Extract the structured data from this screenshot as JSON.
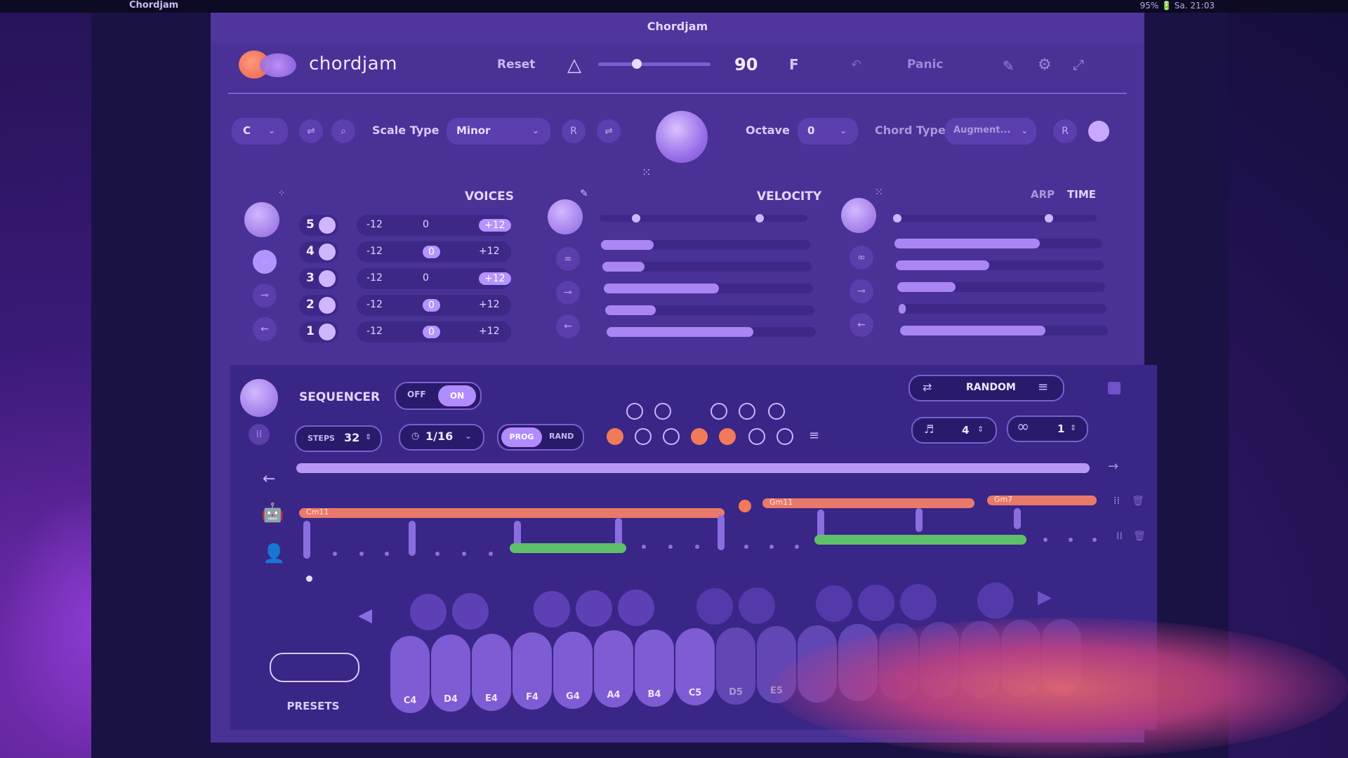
{
  "menubar": {
    "app": "Chordjam",
    "status": "95% 🔋  Sa. 21:03"
  },
  "window": {
    "title": "Chordjam"
  },
  "header": {
    "brand": "chordjam",
    "reset": "Reset",
    "bpm": "90",
    "key": "F",
    "panic": "Panic"
  },
  "controls": {
    "root": "C",
    "scale_label": "Scale Type",
    "scale": "Minor",
    "r": "R",
    "octave_label": "Octave",
    "octave": "0",
    "chord_label": "Chord Type",
    "chord": "Augment..."
  },
  "voices": {
    "title": "VOICES",
    "rows": [
      {
        "n": "5",
        "lo": "-12",
        "mid": "0",
        "hi": "+12"
      },
      {
        "n": "4",
        "lo": "-12",
        "mid": "0",
        "hi": "+12"
      },
      {
        "n": "3",
        "lo": "-12",
        "mid": "0",
        "hi": "+12"
      },
      {
        "n": "2",
        "lo": "-12",
        "mid": "0",
        "hi": "+12"
      },
      {
        "n": "1",
        "lo": "-12",
        "mid": "0",
        "hi": "+12"
      }
    ]
  },
  "velocity": {
    "title": "VELOCITY",
    "levels": [
      0.25,
      0.2,
      0.55,
      0.24,
      0.7
    ]
  },
  "arp": {
    "arp": "ARP",
    "time": "TIME",
    "levels": [
      0.7,
      0.45,
      0.28,
      0.03,
      0.7
    ]
  },
  "sequencer": {
    "title": "SEQUENCER",
    "off": "OFF",
    "on": "ON",
    "steps_label": "STEPS",
    "steps": "32",
    "rate": "1/16",
    "prog": "PROG",
    "rand": "RAND",
    "random": "RANDOM",
    "count1": "4",
    "count2": "1",
    "chords": [
      "Cm11",
      "Gm11",
      "Gm7"
    ]
  },
  "keys": [
    "C4",
    "D4",
    "E4",
    "F4",
    "G4",
    "A4",
    "B4",
    "C5",
    "D5",
    "E5",
    "",
    "",
    "",
    "",
    "",
    "",
    ""
  ],
  "presets": "PRESETS"
}
